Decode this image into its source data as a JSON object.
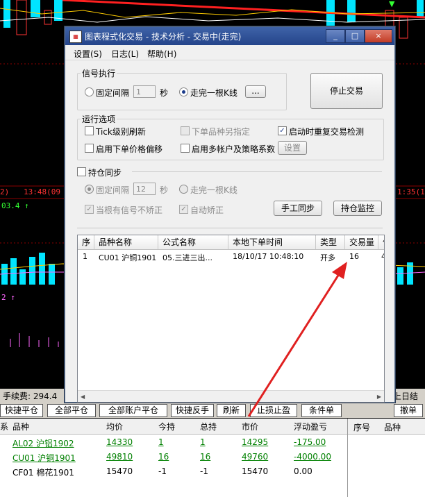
{
  "dialog": {
    "title": "图表程式化交易 - 技术分析 - 交易中(走完)",
    "app_icon": "app-logo-icon",
    "minimize": "_",
    "maximize": "□",
    "close": "×",
    "menu": [
      "设置(S)",
      "日志(L)",
      "帮助(H)"
    ]
  },
  "signal": {
    "group": "信号执行",
    "fixed_label": "固定间隔",
    "fixed_value": "1",
    "unit": "秒",
    "bar_label": "走完一根K线",
    "more": "...",
    "stop_button": "停止交易"
  },
  "options": {
    "group": "运行选项",
    "tick_refresh": "Tick级别刷新",
    "separate_order": "下单品种另指定",
    "restart_check": "启动时重复交易检测",
    "price_offset": "启用下单价格偏移",
    "multi_account": "启用多帐户及策略系数",
    "settings_button": "设置"
  },
  "position_sync": {
    "label": "持仓同步",
    "fixed_label": "固定间隔",
    "fixed_value": "12",
    "unit": "秒",
    "bar_label": "走完一根K线",
    "no_signal_fix": "当根有信号不矫正",
    "auto_fix": "自动矫正",
    "manual_sync": "手工同步",
    "monitor": "持仓监控"
  },
  "orders": {
    "headers": [
      "序",
      "品种名称",
      "公式名称",
      "本地下单时间",
      "类型",
      "交易量",
      "价"
    ],
    "rows": [
      [
        "1",
        "CU01 沪铜1901",
        "05.三进三出...",
        "18/10/17 10:48:10",
        "开多",
        "16",
        "4"
      ]
    ]
  },
  "background": {
    "status_text": "手续费: 294.4",
    "status_right": "上日结算",
    "time_left": "2)",
    "time_mid": "13:48(09",
    "time_right": "1:35(1",
    "price_up": "03.4 ↑",
    "price_purple": "2 ↑",
    "toolbar": [
      "快捷平仓",
      "全部平仓",
      "全部账户平仓",
      "快捷反手",
      "刷新",
      "止损止盈",
      "条件单",
      "撤单"
    ],
    "table_headers": [
      "系",
      "品种",
      "均价",
      "今持",
      "总持",
      "市价",
      "浮动盈亏"
    ],
    "rows": [
      [
        "AL02 沪铝1902",
        "14330",
        "1",
        "1",
        "14295",
        "-175.00"
      ],
      [
        "CU01 沪铜1901",
        "49810",
        "16",
        "16",
        "49760",
        "-4000.00"
      ],
      [
        "CF01 棉花1901",
        "15470",
        "-1",
        "-1",
        "15470",
        "0.00"
      ]
    ],
    "right_headers": [
      "序号",
      "品种"
    ]
  },
  "colors": {
    "titlebar": "#2b4c93",
    "profit_green": "#008000",
    "arrow_red": "#e02020",
    "candle_cyan": "#00e5ff",
    "candle_red": "#ff3333"
  }
}
